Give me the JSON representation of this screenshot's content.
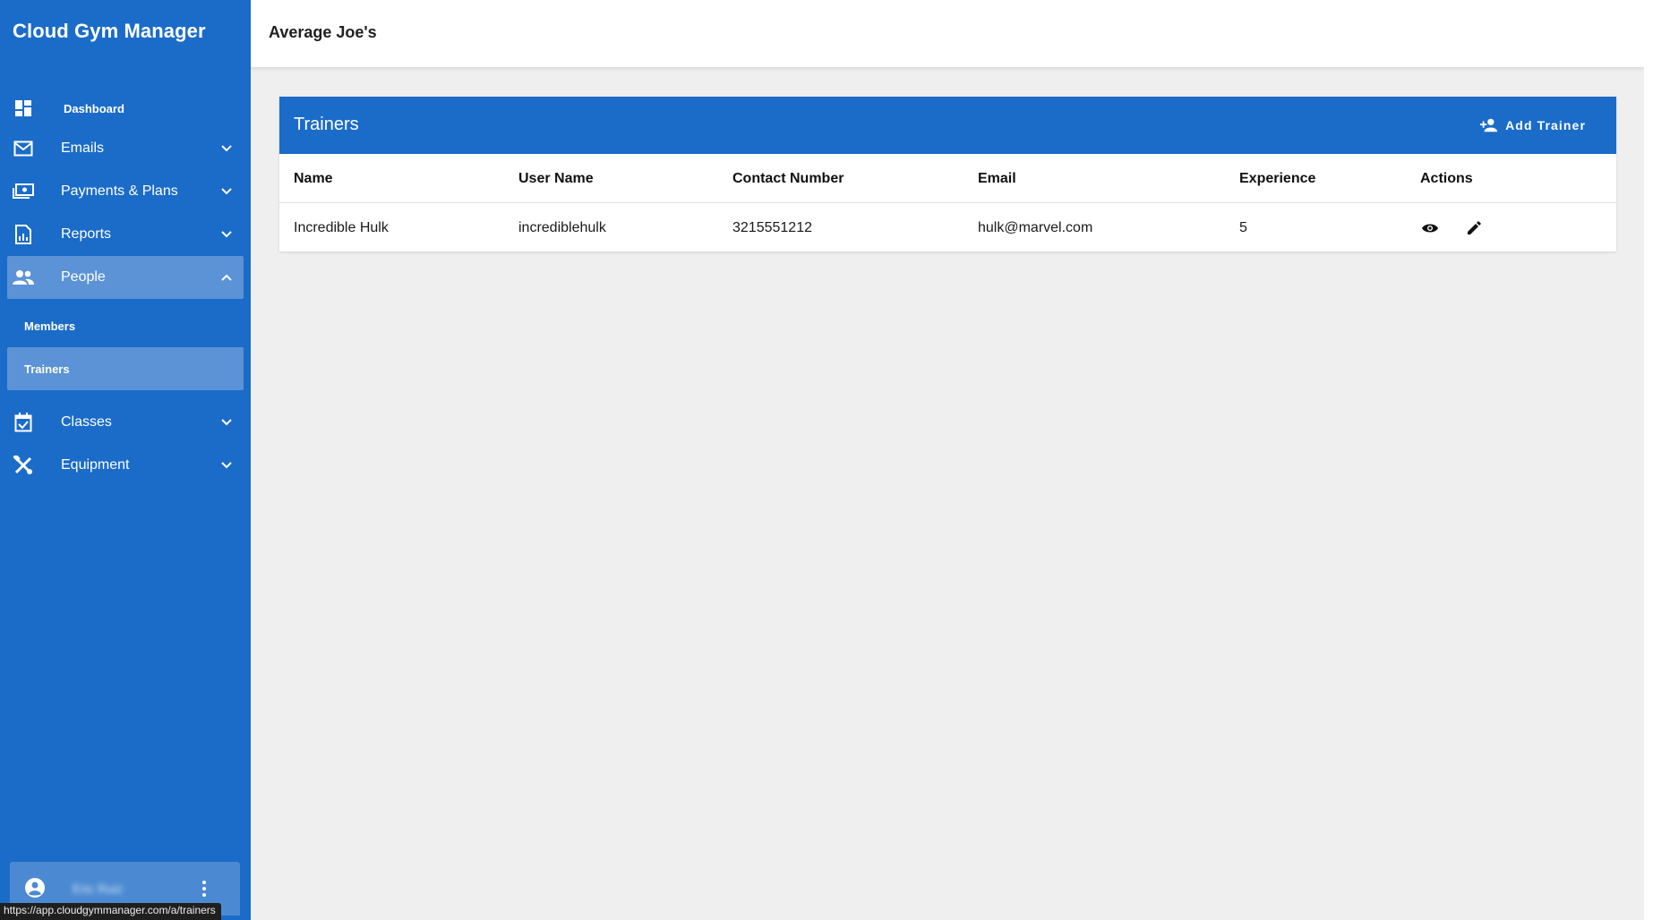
{
  "sidebar": {
    "brand": "Cloud Gym Manager",
    "items": [
      {
        "label": "Dashboard",
        "icon": "dashboard-icon"
      },
      {
        "label": "Emails",
        "icon": "mail-icon"
      },
      {
        "label": "Payments & Plans",
        "icon": "payments-icon"
      },
      {
        "label": "Reports",
        "icon": "reports-icon"
      },
      {
        "label": "People",
        "icon": "people-icon",
        "expanded": true,
        "children": [
          {
            "label": "Members"
          },
          {
            "label": "Trainers",
            "selected": true
          }
        ]
      },
      {
        "label": "Classes",
        "icon": "calendar-check-icon"
      },
      {
        "label": "Equipment",
        "icon": "tools-icon"
      }
    ],
    "user_name": "Eric Ruiz"
  },
  "topbar": {
    "title": "Average Joe's"
  },
  "trainers": {
    "title": "Trainers",
    "add_button": "Add Trainer",
    "columns": [
      "Name",
      "User Name",
      "Contact Number",
      "Email",
      "Experience",
      "Actions"
    ],
    "rows": [
      {
        "name": "Incredible Hulk",
        "username": "incrediblehulk",
        "contact": "3215551212",
        "email": "hulk@marvel.com",
        "experience": "5"
      }
    ]
  },
  "status_url": "https://app.cloudgymmanager.com/a/trainers",
  "colors": {
    "primary": "#1b6cc8",
    "active": "#5b93d6",
    "background": "#efefef"
  }
}
